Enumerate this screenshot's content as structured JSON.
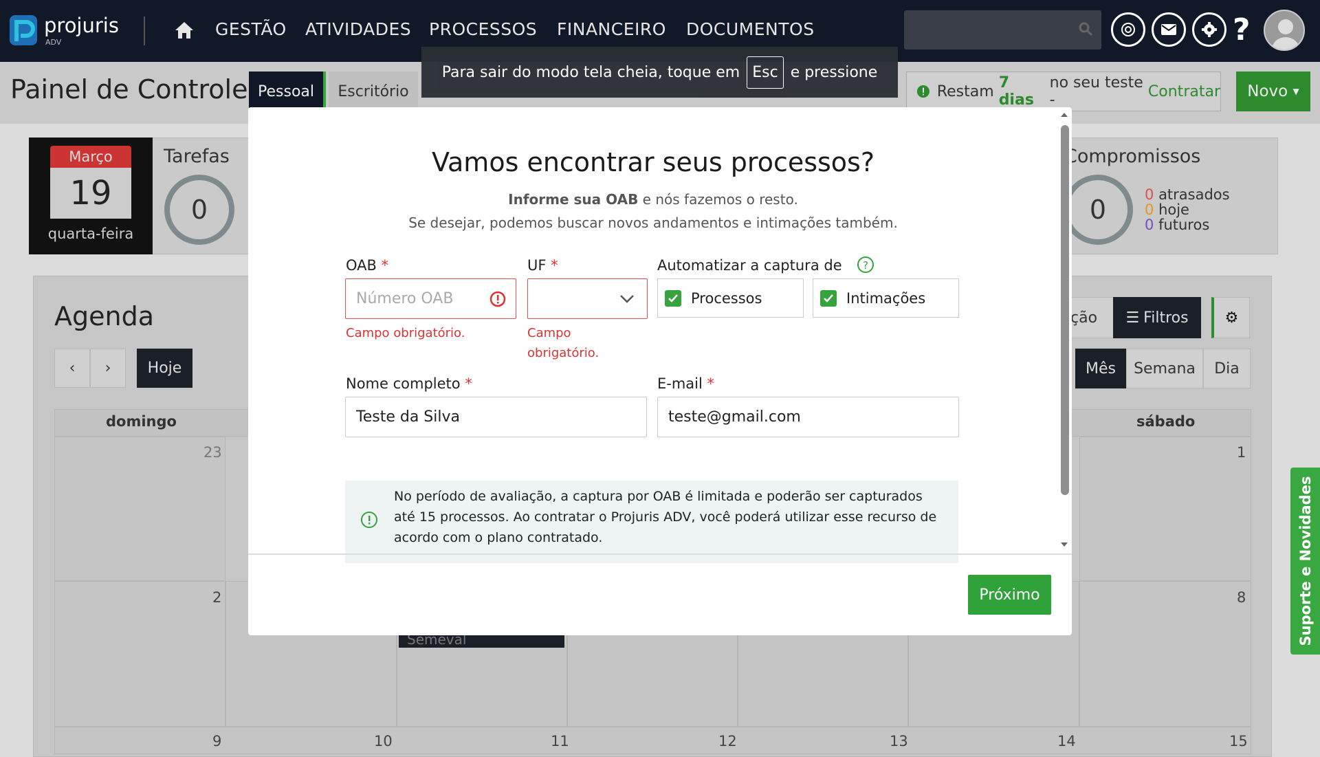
{
  "app": {
    "brand": "projuris",
    "brand_sub": "ADV"
  },
  "nav": {
    "items": [
      "GESTÃO",
      "ATIVIDADES",
      "PROCESSOS",
      "FINANCEIRO",
      "DOCUMENTOS"
    ]
  },
  "header": {
    "title": "Painel de Controle",
    "tabs": [
      "Pessoal",
      "Escritório"
    ],
    "trial_prefix": "Restam",
    "trial_days": "7 dias",
    "trial_middle": "no seu teste -",
    "trial_link": "Contratar",
    "new_button": "Novo"
  },
  "calendar_card": {
    "month": "Março",
    "day": "19",
    "weekday": "quarta-feira"
  },
  "tarefas": {
    "title": "Tarefas",
    "count": "0"
  },
  "compromissos": {
    "title": "Compromissos",
    "count": "0",
    "stats": [
      {
        "value": "0",
        "label": "atrasados",
        "color": "#d9534f"
      },
      {
        "value": "0",
        "label": "hoje",
        "color": "#e69526"
      },
      {
        "value": "0",
        "label": "futuros",
        "color": "#7b4fb8"
      }
    ]
  },
  "agenda": {
    "title": "Agenda",
    "today": "Hoje",
    "filter_partial": "ção",
    "filters": "Filtros",
    "views": [
      "Mês",
      "Semana",
      "Dia"
    ],
    "days_visible": [
      "domingo",
      "sábado"
    ],
    "dates": [
      "23",
      "1",
      "2",
      "8",
      "9",
      "10",
      "11",
      "12",
      "13",
      "14",
      "15"
    ],
    "event_partial": "Semeval"
  },
  "fullscreen_banner": {
    "before": "Para sair do modo tela cheia, toque em",
    "key": "Esc",
    "after": "e pressione"
  },
  "modal": {
    "title": "Vamos encontrar seus processos?",
    "subtitle_bold": "Informe sua OAB",
    "subtitle_rest": "e nós fazemos o resto.",
    "subtitle2": "Se desejar, podemos buscar novos andamentos e intimações também.",
    "oab_label": "OAB",
    "oab_placeholder": "Número OAB",
    "oab_error": "Campo obrigatório.",
    "uf_label": "UF",
    "uf_error_1": "Campo",
    "uf_error_2": "obrigatório.",
    "auto_label": "Automatizar a captura de",
    "check_processos": "Processos",
    "check_intimacoes": "Intimações",
    "name_label": "Nome completo",
    "name_value": "Teste da Silva",
    "email_label": "E-mail",
    "email_value": "teste@gmail.com",
    "required_mark": "*",
    "info_text": "No período de avaliação, a captura por OAB é limitada e poderão ser capturados até 15 processos. Ao contratar o Projuris ADV, você poderá utilizar esse recurso de acordo com o plano contratado.",
    "next_button": "Próximo"
  },
  "side_tab": "Suporte e Novidades"
}
